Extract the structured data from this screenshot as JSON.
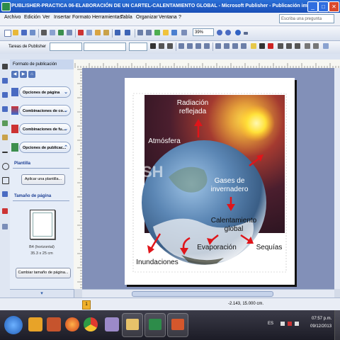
{
  "window": {
    "title": "PUBLISHER-PRACTICA 06-ELABORACIÓN DE UN CARTEL-CALENTAMIENTO GLOBAL - Microsoft Publisher - Publicación impresa",
    "minimize_glyph": "_",
    "maximize_glyph": "□",
    "close_glyph": "✕"
  },
  "menu": {
    "items": [
      "Archivo",
      "Edición",
      "Ver",
      "Insertar",
      "Formato",
      "Herramientas",
      "Tabla",
      "Organizar",
      "Ventana",
      "?"
    ],
    "ask_placeholder": "Escriba una pregunta"
  },
  "toolbar": {
    "zoom": "39%",
    "task_button": "Tareas de Publisher"
  },
  "task_pane": {
    "title": "Formato de publicación",
    "options": [
      {
        "label": "Opciones de página",
        "icon": "page-options-icon"
      },
      {
        "label": "Combinaciones de co...",
        "icon": "color-schemes-icon"
      },
      {
        "label": "Combinaciones de fu...",
        "icon": "font-schemes-icon"
      },
      {
        "label": "Opciones de publicac...",
        "icon": "publication-options-icon"
      }
    ],
    "template_section": "Plantilla",
    "change_template_button": "Aplicar una plantilla...",
    "page_size_section": "Tamaño de página",
    "page_size_name": "B4 (horizontal)",
    "page_size_dims": "35.3 x 25 cm",
    "change_page_size_button": "Cambiar tamaño de página..."
  },
  "poster": {
    "labels": {
      "radiacion": "Radiación",
      "reflejada": "reflejada",
      "atmosfera": "Atmósfera",
      "gases": "Gases de",
      "invernadero": "invernadero",
      "calentamiento": "Calentamiento",
      "global": "global",
      "evaporacion": "Evaporación",
      "sequias": "Sequías",
      "inundaciones": "Inundaciones",
      "watermark": "SH"
    }
  },
  "statusbar": {
    "page_number": "1",
    "position": "-2.143, 15.000 cm."
  },
  "taskbar": {
    "language": "ES",
    "time": "07:57 p.m.",
    "date": "09/12/2013"
  },
  "colors": {
    "title_bar": "#1a4fb8",
    "workspace": "#8290b8",
    "arrow_red": "#e0151a",
    "sun": "#ffe23a"
  }
}
